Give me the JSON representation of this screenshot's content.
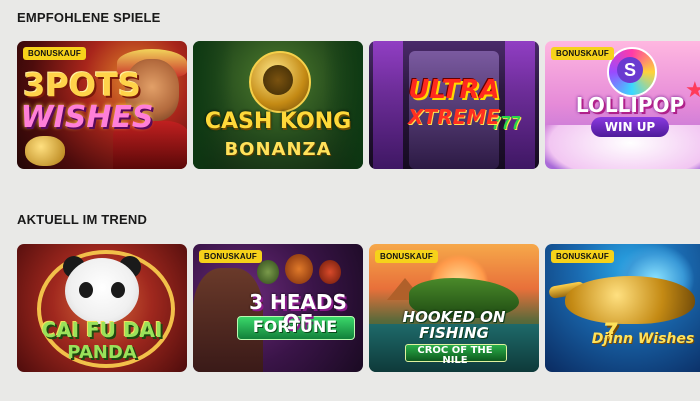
{
  "sections": [
    {
      "title": "EMPFOHLENE SPIELE",
      "games": [
        {
          "logo_line1": "3POTS",
          "logo_line2": "WISHES",
          "badge": "BONUSKAUF"
        },
        {
          "logo_line1": "CASH KONG",
          "logo_line2": "BONANZA",
          "badge": ""
        },
        {
          "logo_line1": "ULTRA",
          "logo_line2": "XTREME",
          "logo_extra": "777",
          "badge": ""
        },
        {
          "logo_line1": "LOLLIPOP",
          "logo_line2": "WIN UP",
          "logo_extra": "S",
          "badge": "BONUSKAUF"
        }
      ]
    },
    {
      "title": "AKTUELL IM TREND",
      "games": [
        {
          "logo_line1": "CAI FU DAI",
          "logo_line2": "PANDA",
          "badge": ""
        },
        {
          "logo_line1": "3 HEADS OF",
          "logo_line2": "FORTUNE",
          "badge": "BONUSKAUF"
        },
        {
          "logo_line1": "HOOKED ON",
          "logo_line2": "FISHING",
          "logo_extra": "CROC OF THE NILE",
          "badge": "BONUSKAUF"
        },
        {
          "logo_line1": "7",
          "logo_line2": "Djinn Wishes",
          "badge": "BONUSKAUF"
        }
      ]
    }
  ],
  "icons": {
    "badge_color": "#f6d21a",
    "page_background": "#e9e9e7"
  }
}
